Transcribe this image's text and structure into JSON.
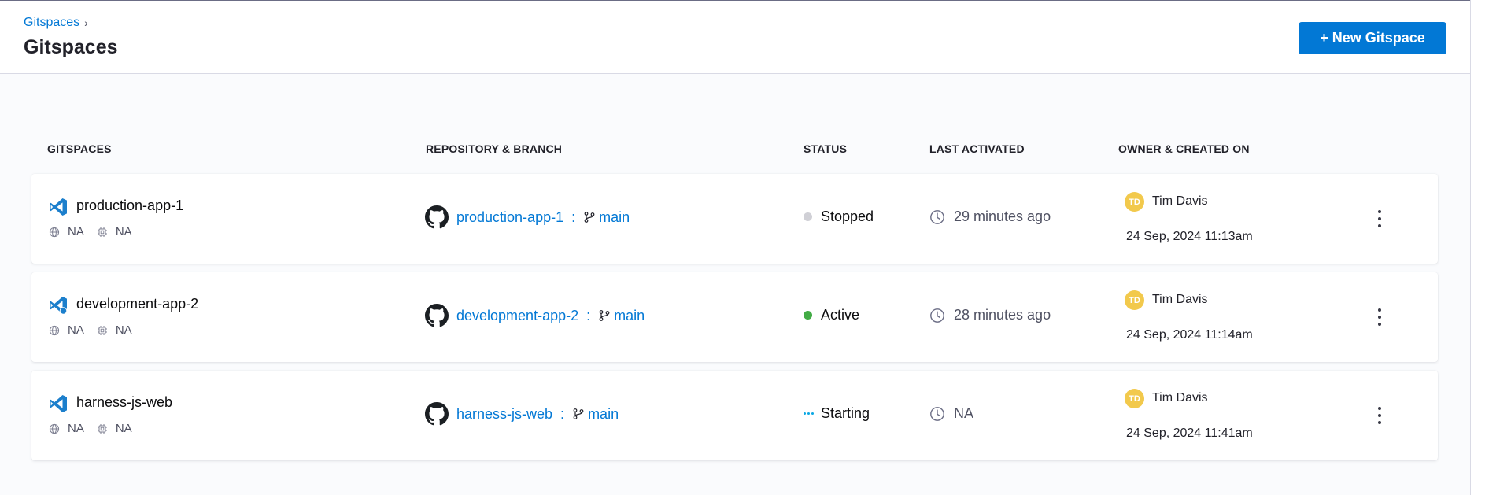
{
  "header": {
    "breadcrumb": "Gitspaces",
    "title": "Gitspaces",
    "new_button": "+ New Gitspace"
  },
  "columns": {
    "gitspaces": "GITSPACES",
    "repo": "REPOSITORY & BRANCH",
    "status": "STATUS",
    "last": "LAST ACTIVATED",
    "owner": "OWNER & CREATED ON"
  },
  "colors": {
    "accent": "#0278d5",
    "stopped": "#d0d0d6",
    "active": "#42ab45",
    "starting": "#0ba8e4",
    "avatar": "#f2c94c"
  },
  "rows": [
    {
      "name": "production-app-1",
      "icon": "vscode-icon",
      "region": "NA",
      "resource": "NA",
      "repo": "production-app-1",
      "branch": "main",
      "status": "Stopped",
      "status_kind": "stopped",
      "last_activated": "29 minutes ago",
      "owner_initials": "TD",
      "owner": "Tim Davis",
      "created": "24 Sep, 2024 11:13am"
    },
    {
      "name": "development-app-2",
      "icon": "vscode-web-icon",
      "region": "NA",
      "resource": "NA",
      "repo": "development-app-2",
      "branch": "main",
      "status": "Active",
      "status_kind": "active",
      "last_activated": "28 minutes ago",
      "owner_initials": "TD",
      "owner": "Tim Davis",
      "created": "24 Sep, 2024 11:14am"
    },
    {
      "name": "harness-js-web",
      "icon": "vscode-icon",
      "region": "NA",
      "resource": "NA",
      "repo": "harness-js-web",
      "branch": "main",
      "status": "Starting",
      "status_kind": "starting",
      "last_activated": "NA",
      "owner_initials": "TD",
      "owner": "Tim Davis",
      "created": "24 Sep, 2024 11:41am"
    }
  ]
}
